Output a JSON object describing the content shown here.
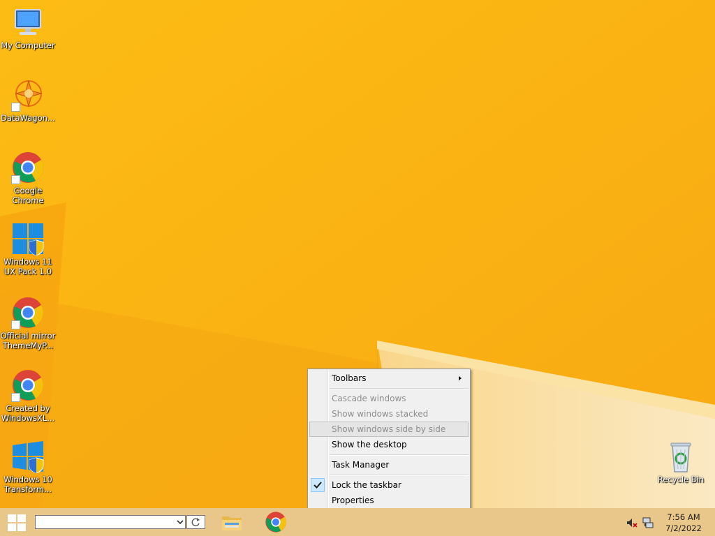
{
  "desktop": {
    "icons": [
      {
        "label": "My Computer",
        "icon": "computer-icon"
      },
      {
        "label": "DataWagon...",
        "icon": "datawagon-icon"
      },
      {
        "label": "Google Chrome",
        "icon": "chrome-icon"
      },
      {
        "label": "Windows 11 UX Pack 1.0",
        "icon": "windows-shield-icon"
      },
      {
        "label": "Official mirror ThemeMyP...",
        "icon": "chrome-icon"
      },
      {
        "label": "Created by WindowsXL...",
        "icon": "chrome-icon"
      },
      {
        "label": "Windows 10 Transform...",
        "icon": "windows-shield-icon"
      },
      {
        "label": "Recycle Bin",
        "icon": "recycle-bin-icon"
      }
    ]
  },
  "context_menu": {
    "items": {
      "toolbars": "Toolbars",
      "cascade": "Cascade windows",
      "stacked": "Show windows stacked",
      "side_by_side": "Show windows side by side",
      "show_desktop": "Show the desktop",
      "task_manager": "Task Manager",
      "lock_taskbar": "Lock the taskbar",
      "properties": "Properties"
    }
  },
  "taskbar": {
    "search": {
      "value": "",
      "placeholder": ""
    },
    "clock": {
      "time": "7:56 AM",
      "date": "7/2/2022"
    }
  },
  "colors": {
    "wallpaper": "#fbb713",
    "taskbar": "#e9c78a",
    "accent": "#0078d7"
  }
}
